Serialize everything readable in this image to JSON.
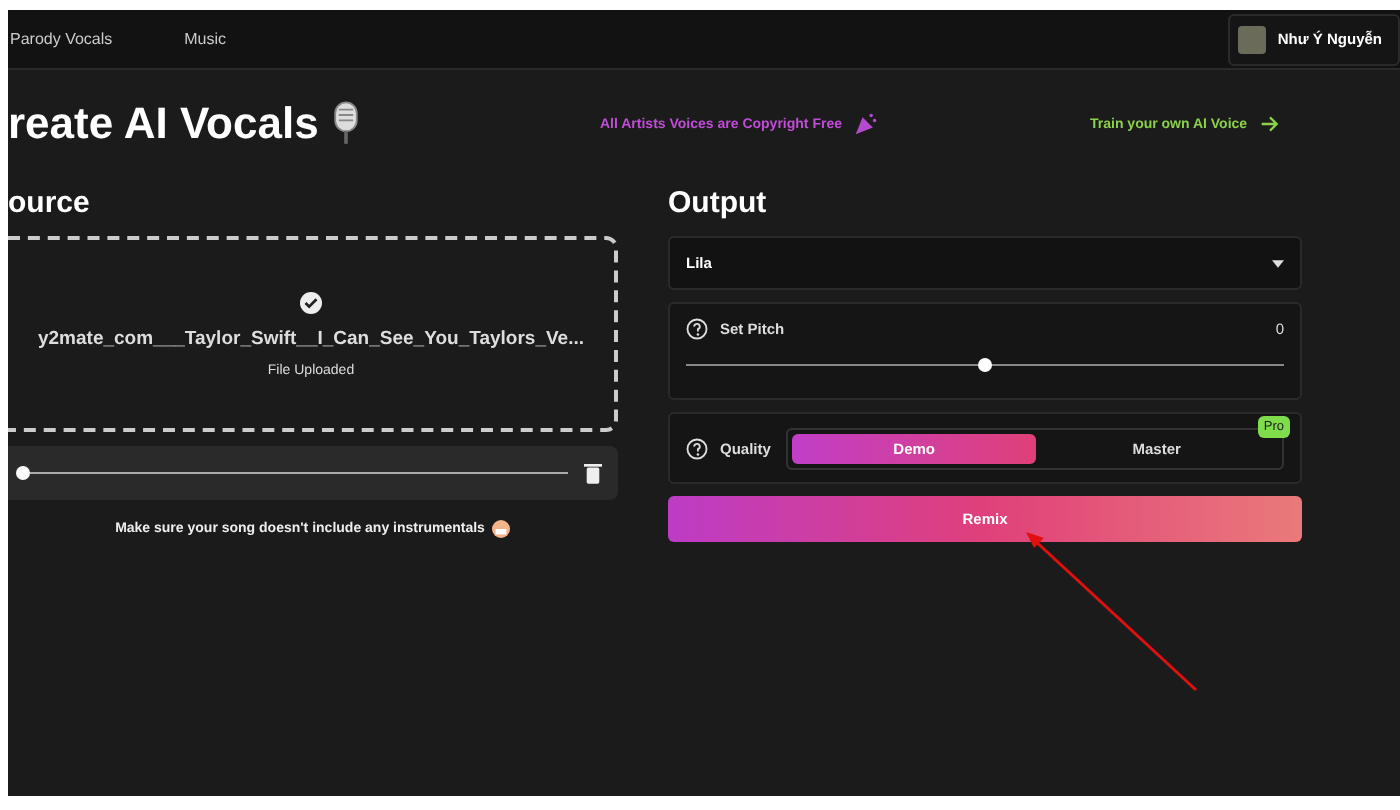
{
  "nav": {
    "items": [
      {
        "label": "Parody Vocals"
      },
      {
        "label": "Music"
      }
    ],
    "user": {
      "name": "Như Ý Nguyễn"
    }
  },
  "header": {
    "title": "reate AI Vocals",
    "notice": "All Artists Voices are Copyright Free",
    "train_link": "Train your own AI Voice"
  },
  "source": {
    "heading": "ource",
    "file_name": "y2mate_com___Taylor_Swift__I_Can_See_You_Taylors_Ve...",
    "status": "File Uploaded",
    "uploaded": true,
    "player": {
      "level": 0.0
    },
    "note": "Make sure your song doesn't include any instrumentals"
  },
  "output": {
    "heading": "Output",
    "voice": "Lila",
    "pitch": {
      "label": "Set Pitch",
      "value": "0",
      "level": 0.5
    },
    "quality": {
      "label": "Quality",
      "options": [
        {
          "label": "Demo",
          "selected": true
        },
        {
          "label": "Master",
          "selected": false,
          "badge": "Pro"
        }
      ]
    },
    "remix_button": "Remix"
  }
}
